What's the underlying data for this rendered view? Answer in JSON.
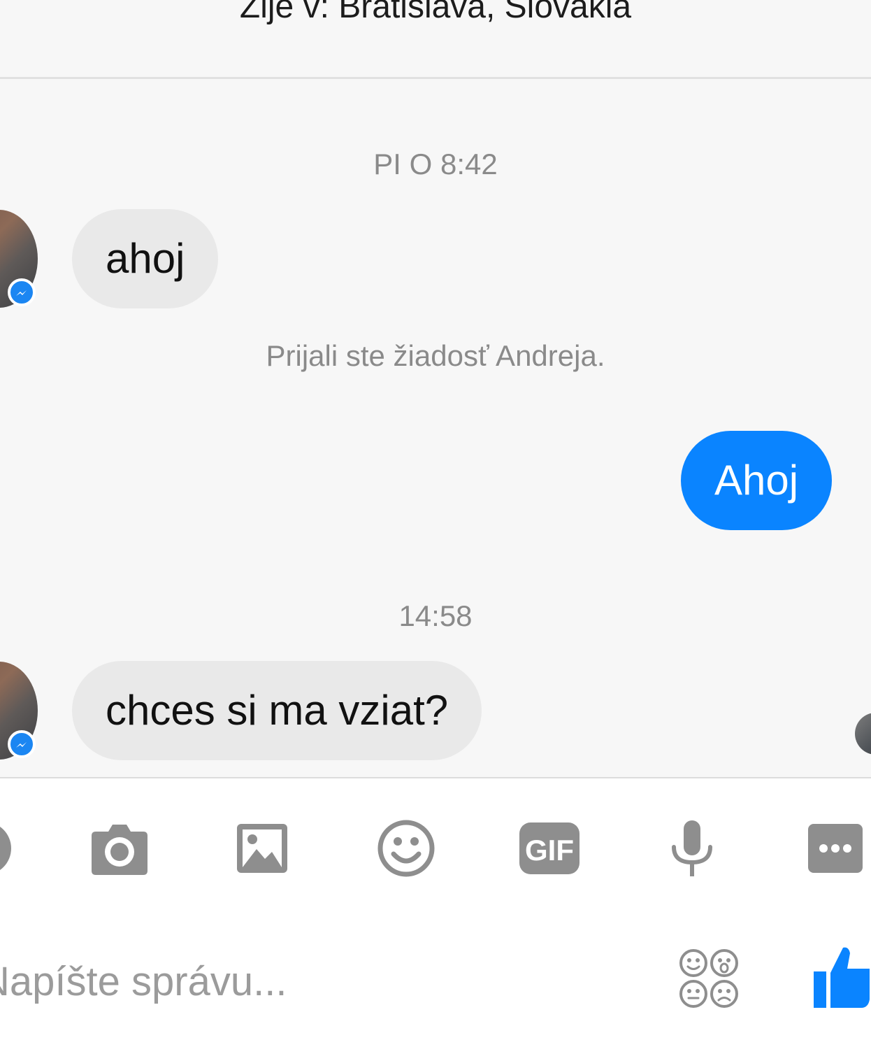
{
  "header": {
    "location": "Žije v: Bratislava, Slovakia"
  },
  "conversation": {
    "timestamp_1": "PI O 8:42",
    "message_1": "ahoj",
    "system_note": "Prijali ste žiadosť Andreja.",
    "message_2": "Ahoj",
    "timestamp_2": "14:58",
    "message_3": "chces si ma vziat?"
  },
  "toolbar": {
    "icons": [
      "camera-icon",
      "image-icon",
      "emoji-icon",
      "gif-icon",
      "microphone-icon",
      "more-icon"
    ],
    "gif_label": "GIF"
  },
  "composer": {
    "placeholder": "Napíšte správu..."
  },
  "colors": {
    "accent": "#0a84ff",
    "incoming_bubble": "#e9e9e9",
    "muted_text": "#8a8a8a",
    "icon_gray": "#8e8e8e"
  }
}
